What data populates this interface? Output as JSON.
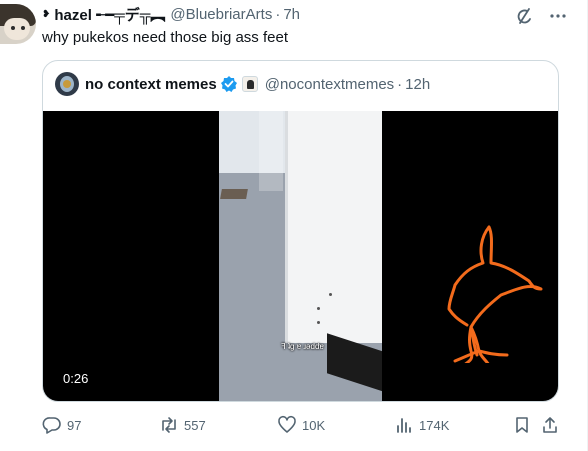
{
  "post": {
    "author_glyph": "❥",
    "author_name": "hazel ╾━╤デ╦︻",
    "author_handle": "@BluebriarArts",
    "separator": "·",
    "time": "7h",
    "text": "why pukekos need those big ass feet"
  },
  "quote": {
    "name": "no context memes",
    "handle": "@nocontextmemes",
    "separator": "·",
    "time": "12h",
    "video": {
      "duration": "0:26",
      "subtitle": "ꟻ ʇg ɐ ɹǝddɐ"
    }
  },
  "actions": {
    "replies": "97",
    "reposts": "557",
    "likes": "10K",
    "views": "174K"
  },
  "icons": {
    "grok": "grok-icon",
    "more": "more-icon",
    "verified": "verified-badge-icon",
    "reply": "reply-icon",
    "repost": "repost-icon",
    "like": "heart-icon",
    "views": "views-icon",
    "bookmark": "bookmark-icon",
    "share": "share-icon"
  },
  "colors": {
    "text": "#0f1419",
    "muted": "#536471",
    "border": "#cfd9de",
    "verified": "#1d9bf0",
    "doodle": "#f36b1c"
  }
}
